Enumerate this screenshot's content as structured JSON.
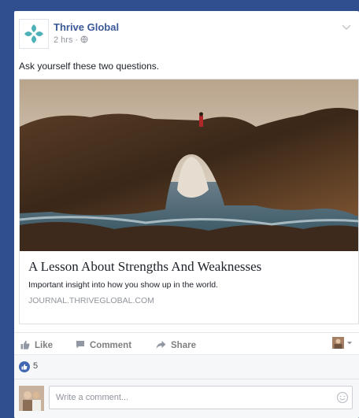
{
  "post": {
    "page_name": "Thrive Global",
    "time": "2 hrs",
    "separator": "·",
    "privacy_icon": "globe-icon",
    "text": "Ask yourself these two questions."
  },
  "link": {
    "title": "A Lesson About Strengths And Weaknesses",
    "description": "Important insight into how you show up in the world.",
    "domain": "JOURNAL.THRIVEGLOBAL.COM"
  },
  "actions": {
    "like_label": "Like",
    "comment_label": "Comment",
    "share_label": "Share"
  },
  "reactions": {
    "count": "5",
    "icon": "like-thumb-icon"
  },
  "composer": {
    "placeholder": "Write a comment...",
    "emoji_icon": "smiley-icon"
  },
  "colors": {
    "brand": "#3b5998",
    "background": "#2f4f8f",
    "logo_teal": "#4fb1b8"
  }
}
